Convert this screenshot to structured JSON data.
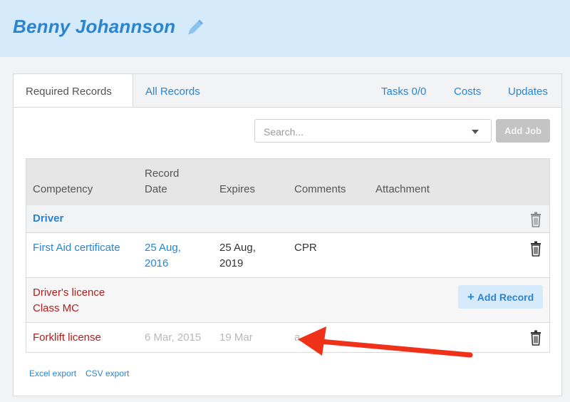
{
  "header": {
    "name": "Benny Johannson"
  },
  "tabs": {
    "required": "Required Records",
    "all": "All Records",
    "tasks": "Tasks 0/0",
    "costs": "Costs",
    "updates": "Updates"
  },
  "toolbar": {
    "search_placeholder": "Search...",
    "add_job": "Add Job"
  },
  "table": {
    "headers": {
      "competency": "Competency",
      "record_line1": "Record",
      "record_line2": "Date",
      "expires": "Expires",
      "comments": "Comments",
      "attachment": "Attachment"
    },
    "group": {
      "name": "Driver"
    },
    "rows": [
      {
        "competency": "First Aid certificate",
        "record_line1": "25 Aug,",
        "record_line2": "2016",
        "expires_line1": "25 Aug,",
        "expires_line2": "2019",
        "comments": "CPR"
      },
      {
        "competency_line1": "Driver's licence",
        "competency_line2": "Class MC",
        "action": "Add Record"
      },
      {
        "competency": "Forklift license",
        "record": "6 Mar, 2015",
        "expires": "19 Mar",
        "comments": "a"
      }
    ]
  },
  "footer": {
    "excel": "Excel export",
    "csv": "CSV export"
  },
  "colors": {
    "accent": "#2a84d0",
    "header_bg": "#d5ebfb",
    "danger": "#b31d1d",
    "annotation_arrow": "#f0311a"
  }
}
